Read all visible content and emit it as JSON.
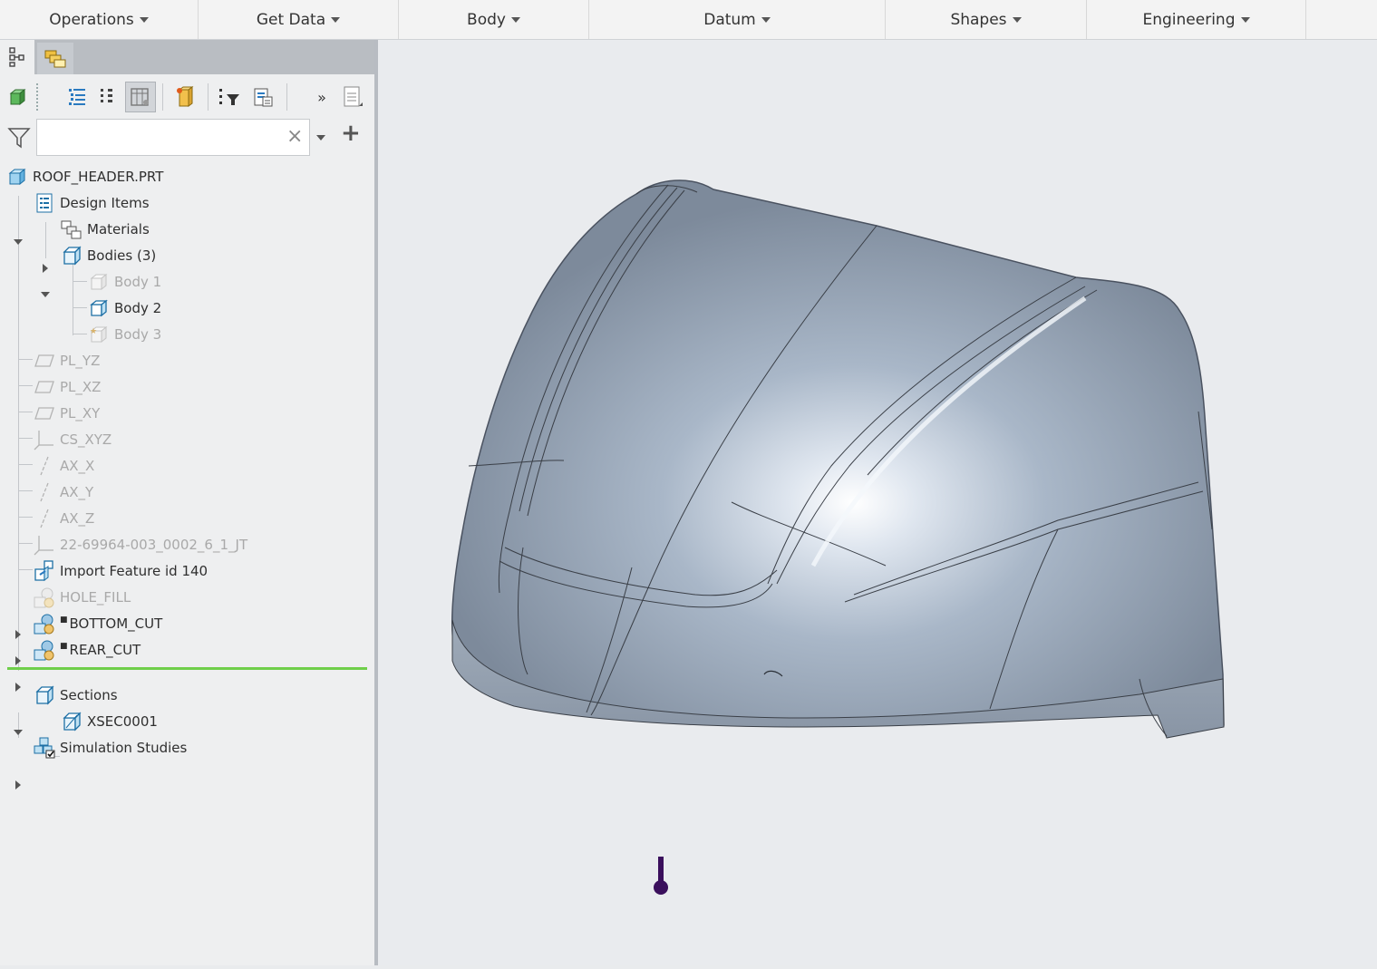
{
  "ribbon": {
    "tabs": [
      {
        "label": "Operations"
      },
      {
        "label": "Get Data"
      },
      {
        "label": "Body"
      },
      {
        "label": "Datum"
      },
      {
        "label": "Shapes"
      },
      {
        "label": "Engineering"
      }
    ]
  },
  "filter": {
    "search_value": "",
    "clear_glyph": "×",
    "add_glyph": "+",
    "more_glyph": "»"
  },
  "tree": {
    "root": "ROOF_HEADER.PRT",
    "design_items": "Design Items",
    "materials": "Materials",
    "bodies": "Bodies (3)",
    "body1": "Body 1",
    "body2": "Body 2",
    "body3": "Body 3",
    "pl_yz": "PL_YZ",
    "pl_xz": "PL_XZ",
    "pl_xy": "PL_XY",
    "cs_xyz": "CS_XYZ",
    "ax_x": "AX_X",
    "ax_y": "AX_Y",
    "ax_z": "AX_Z",
    "jt_cs": "22-69964-003_0002_6_1_JT",
    "import_feature": "Import Feature id 140",
    "hole_fill": "HOLE_FILL",
    "bottom_cut": "BOTTOM_CUT",
    "rear_cut": "REAR_CUT",
    "sections": "Sections",
    "xsec": "XSEC0001",
    "simulation": "Simulation Studies"
  },
  "colors": {
    "model_surface": "#a9b7c8",
    "model_edge": "#3a3f47",
    "insert_indicator": "#6fcf4a",
    "viewport_bg": "#e9ebee",
    "triad_marker": "#3a0f5c"
  }
}
